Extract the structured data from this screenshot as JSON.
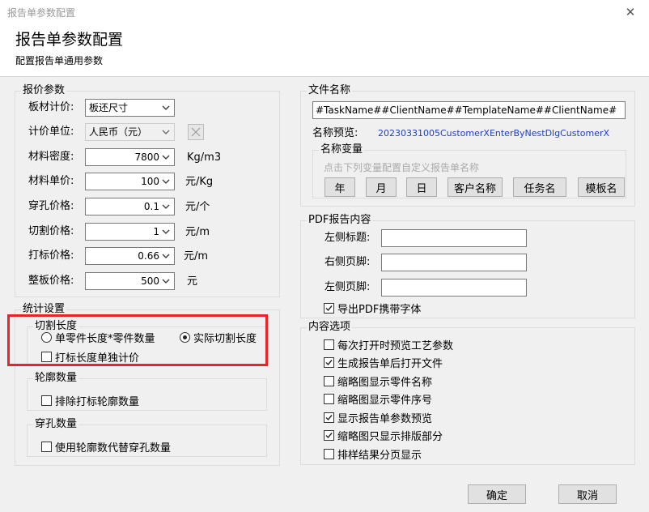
{
  "window": {
    "title": "报告单参数配置",
    "close_glyph": "✕"
  },
  "header": {
    "title": "报告单参数配置",
    "subtitle": "配置报告单通用参数"
  },
  "quote": {
    "title": "报价参数",
    "plate_label": "板材计价:",
    "plate_value": "板还尺寸",
    "unit_label": "计价单位:",
    "unit_value": "人民币（元）",
    "density_label": "材料密度:",
    "density_value": "7800",
    "density_unit": "Kg/m3",
    "price_label": "材料单价:",
    "price_value": "100",
    "price_unit": "元/Kg",
    "pierce_label": "穿孔价格:",
    "pierce_value": "0.1",
    "pierce_unit": "元/个",
    "cut_label": "切割价格:",
    "cut_value": "1",
    "cut_unit": "元/m",
    "mark_label": "打标价格:",
    "mark_value": "0.66",
    "mark_unit": "元/m",
    "sheet_label": "整板价格:",
    "sheet_value": "500",
    "sheet_unit": "元"
  },
  "stats": {
    "title": "统计设置",
    "cut_len_title": "切割长度",
    "radio_single": "单零件长度*零件数量",
    "radio_actual": "实际切割长度",
    "mark_separate": "打标长度单独计价",
    "contour_title": "轮廓数量",
    "exclude_mark_contour": "排除打标轮廓数量",
    "pierce_title": "穿孔数量",
    "use_contour_for_pierce": "使用轮廓数代替穿孔数量"
  },
  "filename": {
    "title": "文件名称",
    "pattern": "#TaskName##ClientName##TemplateName##ClientName#",
    "preview_label": "名称预览:",
    "preview_value": "20230331005CustomerXEnterByNestDlgCustomerX",
    "vars_title": "名称变量",
    "vars_hint": "点击下列变量配置自定义报告单名称",
    "btn_year": "年",
    "btn_month": "月",
    "btn_day": "日",
    "btn_client": "客户名称",
    "btn_task": "任务名",
    "btn_template": "模板名"
  },
  "pdf": {
    "title": "PDF报告内容",
    "left_title_label": "左侧标题:",
    "right_footer_label": "右侧页脚:",
    "left_footer_label": "左侧页脚:",
    "left_title_value": "",
    "right_footer_value": "",
    "left_footer_value": "",
    "embed_font": "导出PDF携带字体"
  },
  "content": {
    "title": "内容选项",
    "opt1": "每次打开时预览工艺参数",
    "opt2": "生成报告单后打开文件",
    "opt3": "缩略图显示零件名称",
    "opt4": "缩略图显示零件序号",
    "opt5": "显示报告单参数预览",
    "opt6": "缩略图只显示排版部分",
    "opt7": "排样结果分页显示"
  },
  "footer": {
    "ok": "确定",
    "cancel": "取消"
  },
  "colors": {
    "highlight": "#e8232a",
    "preview_link": "#1f3fbf"
  }
}
